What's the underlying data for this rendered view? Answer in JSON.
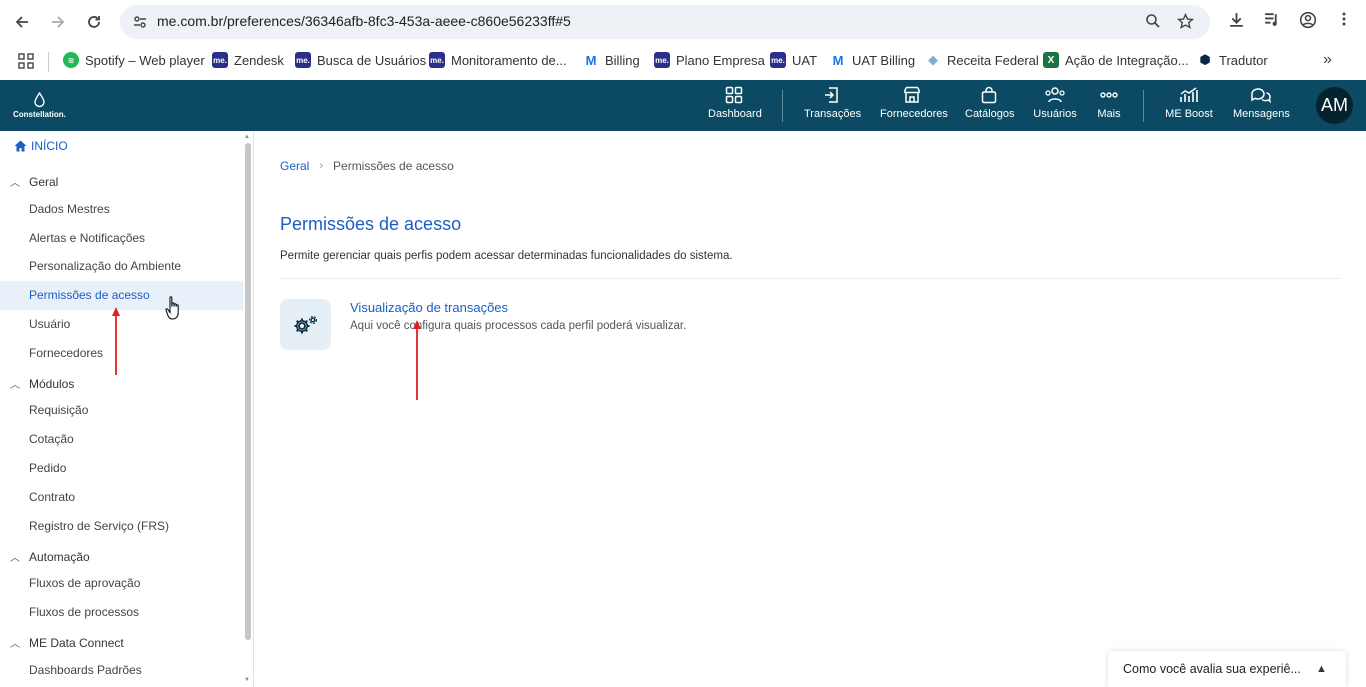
{
  "browser": {
    "url": "me.com.br/preferences/36346afb-8fc3-453a-aeee-c860e56233ff#5",
    "bookmarks": [
      {
        "label": "Spotify – Web player",
        "icon": "spotify-icon",
        "color": "#1db954"
      },
      {
        "label": "Zendesk",
        "icon": "me-icon",
        "color": "#2a2f8a"
      },
      {
        "label": "Busca de Usuários",
        "icon": "me-icon",
        "color": "#2a2f8a"
      },
      {
        "label": "Monitoramento de...",
        "icon": "me-icon",
        "color": "#2a2f8a"
      },
      {
        "label": "Billing",
        "icon": "m-icon",
        "color": "#1a73e8"
      },
      {
        "label": "Plano Empresa",
        "icon": "me-icon",
        "color": "#2a2f8a"
      },
      {
        "label": "UAT",
        "icon": "me-icon",
        "color": "#2a2f8a"
      },
      {
        "label": "UAT Billing",
        "icon": "m-icon",
        "color": "#1a73e8"
      },
      {
        "label": "Receita Federal",
        "icon": "diamond-icon",
        "color": "#7fb0d8"
      },
      {
        "label": "Ação de Integração...",
        "icon": "excel-icon",
        "color": "#1e7145"
      },
      {
        "label": "Tradutor",
        "icon": "tradutor-icon",
        "color": "#0b2545"
      }
    ]
  },
  "header": {
    "logo_text": "Constellation.",
    "nav": [
      {
        "label": "Dashboard",
        "icon": "dashboard-icon"
      },
      {
        "label": "Transações",
        "icon": "transactions-icon"
      },
      {
        "label": "Fornecedores",
        "icon": "suppliers-icon"
      },
      {
        "label": "Catálogos",
        "icon": "catalog-bag-icon"
      },
      {
        "label": "Usuários",
        "icon": "users-icon"
      },
      {
        "label": "Mais",
        "icon": "more-icon"
      },
      {
        "label": "ME Boost",
        "icon": "boost-chart-icon"
      },
      {
        "label": "Mensagens",
        "icon": "messages-icon"
      }
    ],
    "avatar_initials": "AM"
  },
  "sidebar": {
    "home": "INÍCIO",
    "sections": [
      {
        "title": "Geral",
        "items": [
          "Dados Mestres",
          "Alertas e Notificações",
          "Personalização do Ambiente",
          "Permissões de acesso",
          "Usuário",
          "Fornecedores"
        ]
      },
      {
        "title": "Módulos",
        "items": [
          "Requisição",
          "Cotação",
          "Pedido",
          "Contrato",
          "Registro de Serviço (FRS)"
        ]
      },
      {
        "title": "Automação",
        "items": [
          "Fluxos de aprovação",
          "Fluxos de processos"
        ]
      },
      {
        "title": "ME Data Connect",
        "items": [
          "Dashboards Padrões"
        ]
      }
    ],
    "active_item": "Permissões de acesso"
  },
  "main": {
    "breadcrumb": [
      "Geral",
      "Permissões de acesso"
    ],
    "title": "Permissões de acesso",
    "description": "Permite gerenciar quais perfis podem acessar determinadas funcionalidades do sistema.",
    "card": {
      "title": "Visualização de transações",
      "description": "Aqui você configura quais processos cada perfil poderá visualizar.",
      "icon": "gears-icon"
    }
  },
  "feedback": {
    "text": "Como você avalia sua experiê..."
  },
  "colors": {
    "header": "#0c4a63",
    "accent": "#1b5ec6",
    "annotation": "#e02020"
  }
}
